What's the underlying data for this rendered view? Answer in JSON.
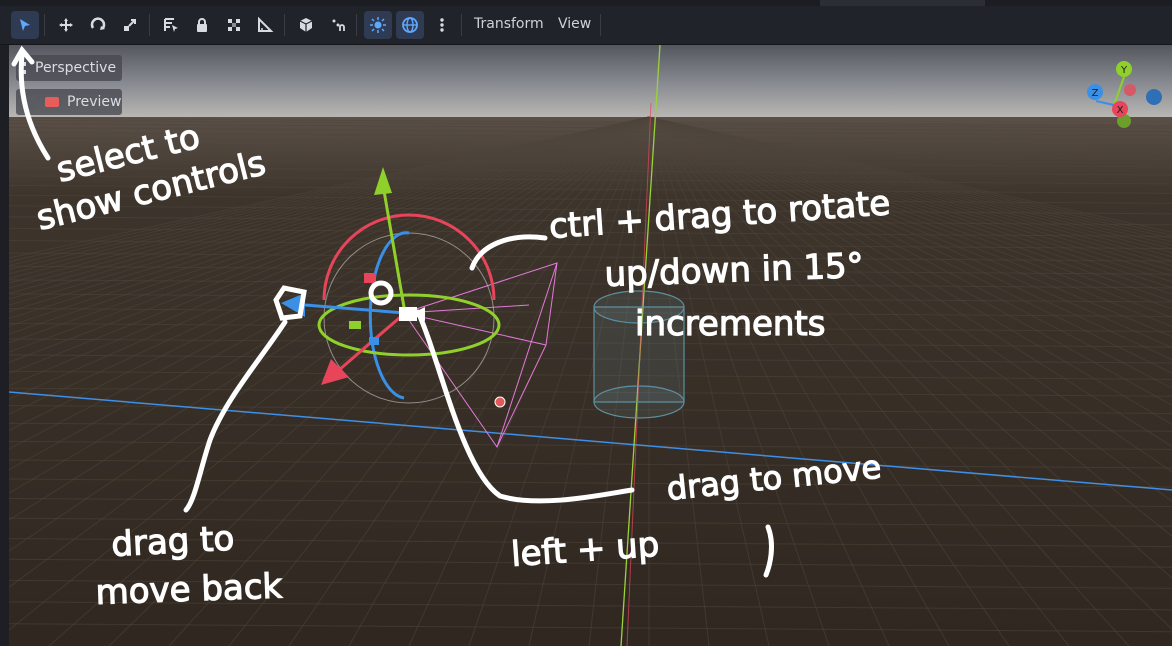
{
  "toolbar": {
    "icons": [
      "select-icon",
      "move-icon",
      "rotate-icon",
      "scale-icon",
      "list-select-icon",
      "lock-icon",
      "group-icon",
      "ruler-icon",
      "local-space-icon",
      "snap-icon",
      "sun-icon",
      "globe-icon",
      "more-icon"
    ],
    "menus": {
      "transform": "Transform",
      "view": "View"
    }
  },
  "viewport": {
    "perspective_label": "Perspective",
    "preview_label": "Preview"
  },
  "gizmo_axes": {
    "x": "X",
    "y": "Y",
    "z": "Z"
  },
  "annotations": {
    "select_line1": "select to",
    "select_line2": "show controls",
    "rotate_line1": "ctrl + drag to rotate",
    "rotate_line2": "up/down in 15°",
    "rotate_line3": "increments",
    "move_line1": "drag to move",
    "move_line2": "left + up",
    "back_line1": "drag to",
    "back_line2": "move back"
  },
  "colors": {
    "toolbar_bg": "#21232a",
    "accent": "#5fa8ff",
    "axis_x": "#e8455b",
    "axis_y": "#8fd12a",
    "axis_z": "#3a8fe6",
    "grid_floor": "#3a3129",
    "sky": "#5a5c63"
  }
}
